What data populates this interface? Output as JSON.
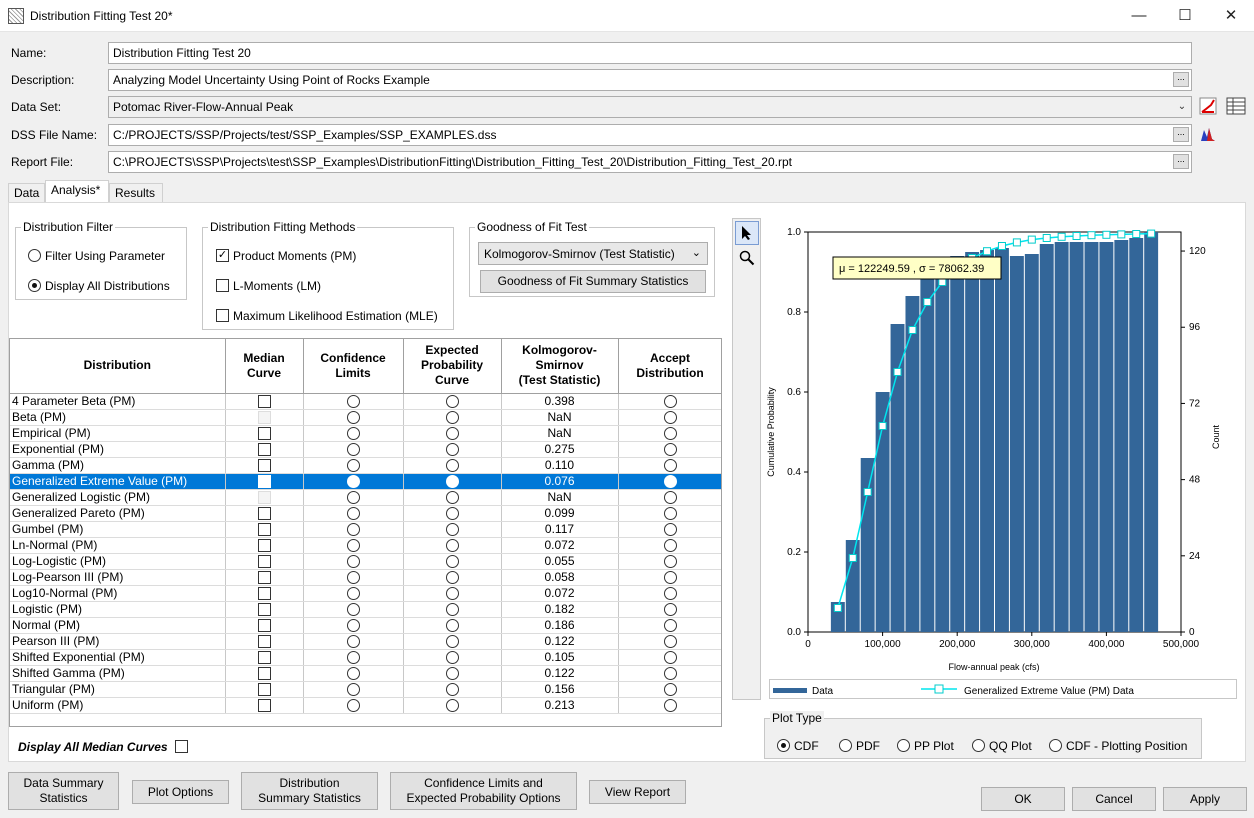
{
  "window": {
    "title": "Distribution Fitting Test 20*",
    "minimize": "—",
    "maximize": "☐",
    "close": "✕"
  },
  "form": {
    "name_label": "Name:",
    "name_value": "Distribution Fitting Test 20",
    "description_label": "Description:",
    "description_value": "Analyzing Model Uncertainty Using Point of Rocks Example",
    "dataset_label": "Data Set:",
    "dataset_value": "Potomac River-Flow-Annual Peak",
    "dss_label": "DSS File Name:",
    "dss_value": "C:/PROJECTS/SSP/Projects/test/SSP_Examples/SSP_EXAMPLES.dss",
    "report_label": "Report File:",
    "report_value": "C:\\PROJECTS\\SSP\\Projects\\test\\SSP_Examples\\DistributionFitting\\Distribution_Fitting_Test_20\\Distribution_Fitting_Test_20.rpt",
    "ellipsis": "..."
  },
  "tabs": [
    {
      "label": "Data"
    },
    {
      "label": "Analysis*"
    },
    {
      "label": "Results"
    }
  ],
  "filter": {
    "title": "Distribution Filter",
    "opt1": "Filter Using Parameter",
    "opt2": "Display All Distributions"
  },
  "methods": {
    "title": "Distribution Fitting Methods",
    "pm": "Product Moments (PM)",
    "lm": "L-Moments (LM)",
    "mle": "Maximum Likelihood Estimation (MLE)"
  },
  "gof": {
    "title": "Goodness of Fit Test",
    "selected": "Kolmogorov-Smirnov (Test Statistic)",
    "summary_button": "Goodness of Fit Summary Statistics"
  },
  "table": {
    "headers": {
      "distribution": "Distribution",
      "median_a": "Median",
      "median_b": "Curve",
      "conf_a": "Confidence",
      "conf_b": "Limits",
      "exp_a": "Expected",
      "exp_b": "Probability",
      "exp_c": "Curve",
      "ks_a": "Kolmogorov-",
      "ks_b": "Smirnov",
      "ks_c": "(Test Statistic)",
      "acc_a": "Accept",
      "acc_b": "Distribution"
    },
    "rows": [
      {
        "name": "4 Parameter Beta (PM)",
        "ks": "0.398"
      },
      {
        "name": "Beta (PM)",
        "ks": "NaN"
      },
      {
        "name": "Empirical (PM)",
        "ks": "NaN"
      },
      {
        "name": "Exponential (PM)",
        "ks": "0.275"
      },
      {
        "name": "Gamma (PM)",
        "ks": "0.110"
      },
      {
        "name": "Generalized Extreme Value (PM)",
        "ks": "0.076"
      },
      {
        "name": "Generalized Logistic (PM)",
        "ks": "NaN"
      },
      {
        "name": "Generalized Pareto (PM)",
        "ks": "0.099"
      },
      {
        "name": "Gumbel (PM)",
        "ks": "0.117"
      },
      {
        "name": "Ln-Normal (PM)",
        "ks": "0.072"
      },
      {
        "name": "Log-Logistic (PM)",
        "ks": "0.055"
      },
      {
        "name": "Log-Pearson III (PM)",
        "ks": "0.058"
      },
      {
        "name": "Log10-Normal (PM)",
        "ks": "0.072"
      },
      {
        "name": "Logistic (PM)",
        "ks": "0.182"
      },
      {
        "name": "Normal (PM)",
        "ks": "0.186"
      },
      {
        "name": "Pearson III (PM)",
        "ks": "0.122"
      },
      {
        "name": "Shifted Exponential (PM)",
        "ks": "0.105"
      },
      {
        "name": "Shifted Gamma (PM)",
        "ks": "0.122"
      },
      {
        "name": "Triangular (PM)",
        "ks": "0.156"
      },
      {
        "name": "Uniform (PM)",
        "ks": "0.213"
      }
    ]
  },
  "display_all_median": "Display All Median Curves",
  "chart_data": {
    "type": "bar",
    "xlabel": "Flow-annual peak (cfs)",
    "ylabel": "Cumulative Probability",
    "y2label": "Count",
    "xlim": [
      0,
      500000
    ],
    "ylim": [
      0,
      1.0
    ],
    "y2lim": [
      0,
      126
    ],
    "xticks": [
      "0",
      "100,000",
      "200,000",
      "300,000",
      "400,000",
      "500,000"
    ],
    "yticks": [
      "0.0",
      "0.2",
      "0.4",
      "0.6",
      "0.8",
      "1.0"
    ],
    "y2ticks": [
      "0",
      "24",
      "48",
      "72",
      "96",
      "120"
    ],
    "tooltip": "μ = 122249.59 , σ = 78062.39",
    "legend_position": "bottom",
    "bars": {
      "name": "Data",
      "x": [
        40000,
        60000,
        80000,
        100000,
        120000,
        140000,
        160000,
        180000,
        200000,
        220000,
        240000,
        260000,
        280000,
        300000,
        320000,
        340000,
        360000,
        380000,
        400000,
        420000,
        440000,
        460000
      ],
      "values": [
        0.075,
        0.23,
        0.435,
        0.6,
        0.77,
        0.84,
        0.895,
        0.92,
        0.94,
        0.95,
        0.955,
        0.96,
        0.94,
        0.945,
        0.97,
        0.975,
        0.975,
        0.975,
        0.975,
        0.98,
        0.985,
        1.0
      ]
    },
    "series": [
      {
        "name": "Generalized Extreme Value (PM) Data",
        "x": [
          40000,
          60000,
          80000,
          100000,
          120000,
          140000,
          160000,
          180000,
          200000,
          220000,
          240000,
          260000,
          280000,
          300000,
          320000,
          340000,
          360000,
          380000,
          400000,
          420000,
          440000,
          460000
        ],
        "values": [
          0.06,
          0.185,
          0.35,
          0.515,
          0.65,
          0.755,
          0.825,
          0.875,
          0.91,
          0.935,
          0.952,
          0.965,
          0.974,
          0.981,
          0.985,
          0.988,
          0.99,
          0.992,
          0.993,
          0.994,
          0.995,
          0.996
        ]
      }
    ],
    "colors": {
      "bars": "#336699",
      "line": "#00e5ee"
    }
  },
  "plot_type": {
    "title": "Plot Type",
    "options": [
      "CDF",
      "PDF",
      "PP Plot",
      "QQ Plot",
      "CDF - Plotting Position"
    ]
  },
  "buttons": {
    "data_summary_a": "Data Summary",
    "data_summary_b": "Statistics",
    "plot_options": "Plot Options",
    "dist_summary_a": "Distribution",
    "dist_summary_b": "Summary Statistics",
    "conf_limits_a": "Confidence Limits and",
    "conf_limits_b": "Expected Probability Options",
    "view_report": "View Report",
    "ok": "OK",
    "cancel": "Cancel",
    "apply": "Apply"
  }
}
